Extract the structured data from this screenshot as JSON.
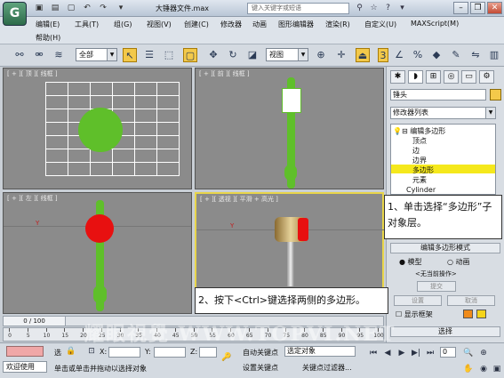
{
  "app": {
    "title": "大锤器文件.max",
    "logo_letter": "G"
  },
  "search": {
    "placeholder": "键入关键字或短语"
  },
  "menubar": {
    "items": [
      "编辑(E)",
      "工具(T)",
      "组(G)",
      "视图(V)",
      "创建(C)",
      "修改器",
      "动画",
      "图形编辑器",
      "渲染(R)",
      "自定义(U)",
      "MAXScript(M)",
      "帮助(H)"
    ]
  },
  "toolbar": {
    "filter_value": "全部",
    "refcoord_value": "视图"
  },
  "viewports": {
    "top": {
      "label": "[ + ][ 顶 ][ 线框 ]"
    },
    "front": {
      "label": "[ + ][ 前 ][ 线框 ]"
    },
    "left": {
      "label": "[ + ][ 左 ][ 线框 ]",
      "axis": "Y"
    },
    "perspective": {
      "label": "[ + ][ 透视 ][ 平滑 + 高光 ]",
      "axis": "Y"
    }
  },
  "command_panel": {
    "object_name": "锤头",
    "modifier_list": "修改器列表",
    "stack": {
      "root": "编辑多边形",
      "children": [
        "顶点",
        "边",
        "边界",
        "多边形",
        "元素"
      ],
      "selected": "多边形",
      "base": "Cylinder"
    },
    "rollout_title": "编辑多边形模式",
    "mode_model": "模型",
    "mode_anim": "动画",
    "no_op": "<无当前操作>",
    "commit": "提交",
    "settings": "设置",
    "cancel": "取消",
    "show_cage": "显示框架",
    "selection_rollout": "选择"
  },
  "callouts": {
    "tip1": "1、单击选择“多边形”子对象层。",
    "tip2": "2、按下<Ctrl>键选择两侧的多边形。"
  },
  "timeline": {
    "frame": "0 / 100",
    "ticks": [
      "0",
      "5",
      "10",
      "15",
      "20",
      "25",
      "30",
      "35",
      "40",
      "45",
      "50",
      "55",
      "60",
      "65",
      "70",
      "75",
      "80",
      "85",
      "90",
      "95",
      "100"
    ]
  },
  "status": {
    "welcome": "欢迎使用",
    "prompt": "单击或单击并拖动以选择对象",
    "sel_label": "选",
    "x_label": "X:",
    "y_label": "Y:",
    "z_label": "Z:",
    "autokey": "自动关键点",
    "setkey": "设置关键点",
    "selected_object": "选定对象",
    "key_filters": "关键点过滤器...",
    "frame_value": "0"
  },
  "watermark": "耀眼視覺 WWW.TOPVI.NET"
}
